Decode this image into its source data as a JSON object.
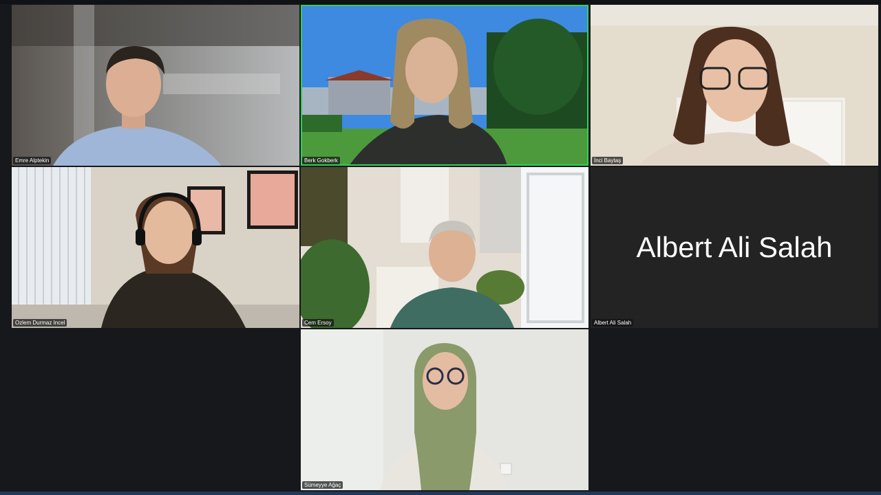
{
  "meeting": {
    "participants": [
      {
        "name": "Emre Alptekin",
        "video": true,
        "active_speaker": false
      },
      {
        "name": "Berk Gokberk",
        "video": true,
        "active_speaker": true
      },
      {
        "name": "İnci Baytaş",
        "video": true,
        "active_speaker": false
      },
      {
        "name": "Ozlem Durmaz Incel",
        "video": true,
        "active_speaker": false
      },
      {
        "name": "Cem Ersoy",
        "video": true,
        "active_speaker": false
      },
      {
        "name": "Albert Ali Salah",
        "video": false,
        "display_name": "Albert Ali Salah",
        "active_speaker": false
      },
      {
        "name": "Sümeyye Ağaç",
        "video": true,
        "active_speaker": false
      }
    ],
    "colors": {
      "background": "#16181c",
      "tile_empty": "#232323",
      "active_speaker_border": "#2fd15d",
      "bottom_bar": "#1f3a5c"
    }
  }
}
